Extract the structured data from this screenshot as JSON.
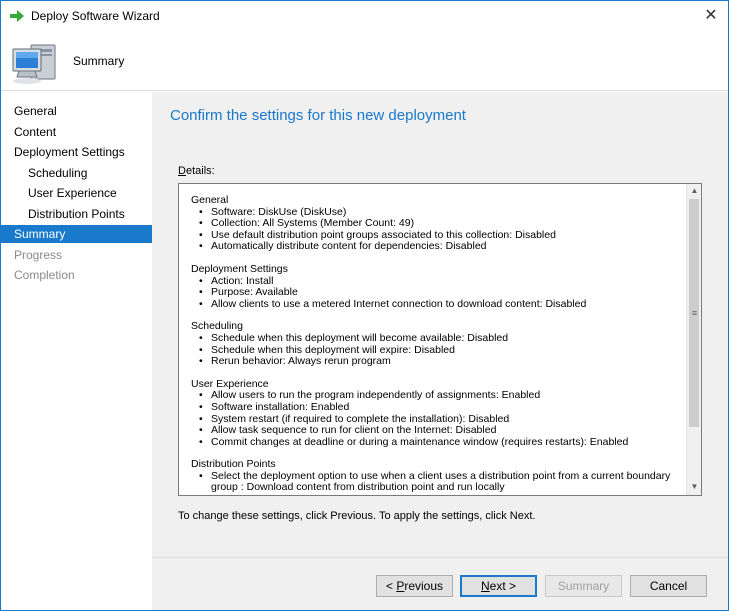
{
  "window": {
    "title": "Deploy Software Wizard",
    "close_glyph": "✕"
  },
  "header": {
    "title": "Summary"
  },
  "nav": {
    "items": [
      {
        "label": "General",
        "state": "normal"
      },
      {
        "label": "Content",
        "state": "normal"
      },
      {
        "label": "Deployment Settings",
        "state": "normal"
      },
      {
        "label": "Scheduling",
        "state": "normal"
      },
      {
        "label": "User Experience",
        "state": "normal"
      },
      {
        "label": "Distribution Points",
        "state": "normal"
      },
      {
        "label": "Summary",
        "state": "active"
      },
      {
        "label": "Progress",
        "state": "disabled"
      },
      {
        "label": "Completion",
        "state": "disabled"
      }
    ]
  },
  "main": {
    "heading": "Confirm the settings for this new deployment",
    "details_label_first": "D",
    "details_label_rest": "etails:",
    "footer_note": "To change these settings, click Previous. To apply the settings, click Next."
  },
  "details": {
    "sections": [
      {
        "title": "General",
        "items": [
          "Software: DiskUse (DiskUse)",
          "Collection: All Systems (Member Count: 49)",
          "Use default distribution point groups associated to this collection: Disabled",
          "Automatically distribute content for dependencies: Disabled"
        ]
      },
      {
        "title": "Deployment Settings",
        "items": [
          "Action: Install",
          "Purpose: Available",
          "Allow clients to use a metered Internet connection to download content: Disabled"
        ]
      },
      {
        "title": "Scheduling",
        "items": [
          "Schedule when this deployment will become available: Disabled",
          "Schedule when this deployment will expire: Disabled",
          "Rerun behavior: Always rerun program"
        ]
      },
      {
        "title": "User Experience",
        "items": [
          "Allow users to run the program independently of assignments: Enabled",
          "Software installation: Enabled",
          "System restart (if required to complete the installation): Disabled",
          "Allow task sequence to run for client on the Internet: Disabled",
          "Commit changes at deadline or during a maintenance window (requires restarts): Enabled"
        ]
      },
      {
        "title": "Distribution Points",
        "items": [
          "Select the deployment option to use when a client uses a distribution point from a current boundary group : Download content from distribution point and run locally"
        ]
      }
    ]
  },
  "buttons": {
    "previous": {
      "prefix": "< ",
      "accel": "P",
      "rest": "revious"
    },
    "next": {
      "accel": "N",
      "rest": "ext >"
    },
    "summary": {
      "label": "Summary"
    },
    "cancel": {
      "label": "Cancel"
    }
  },
  "colors": {
    "accent": "#1979ca",
    "content_bg": "#f0f0f0"
  },
  "icons": {
    "title": "green-arrow-icon",
    "header": "computer-icon"
  }
}
